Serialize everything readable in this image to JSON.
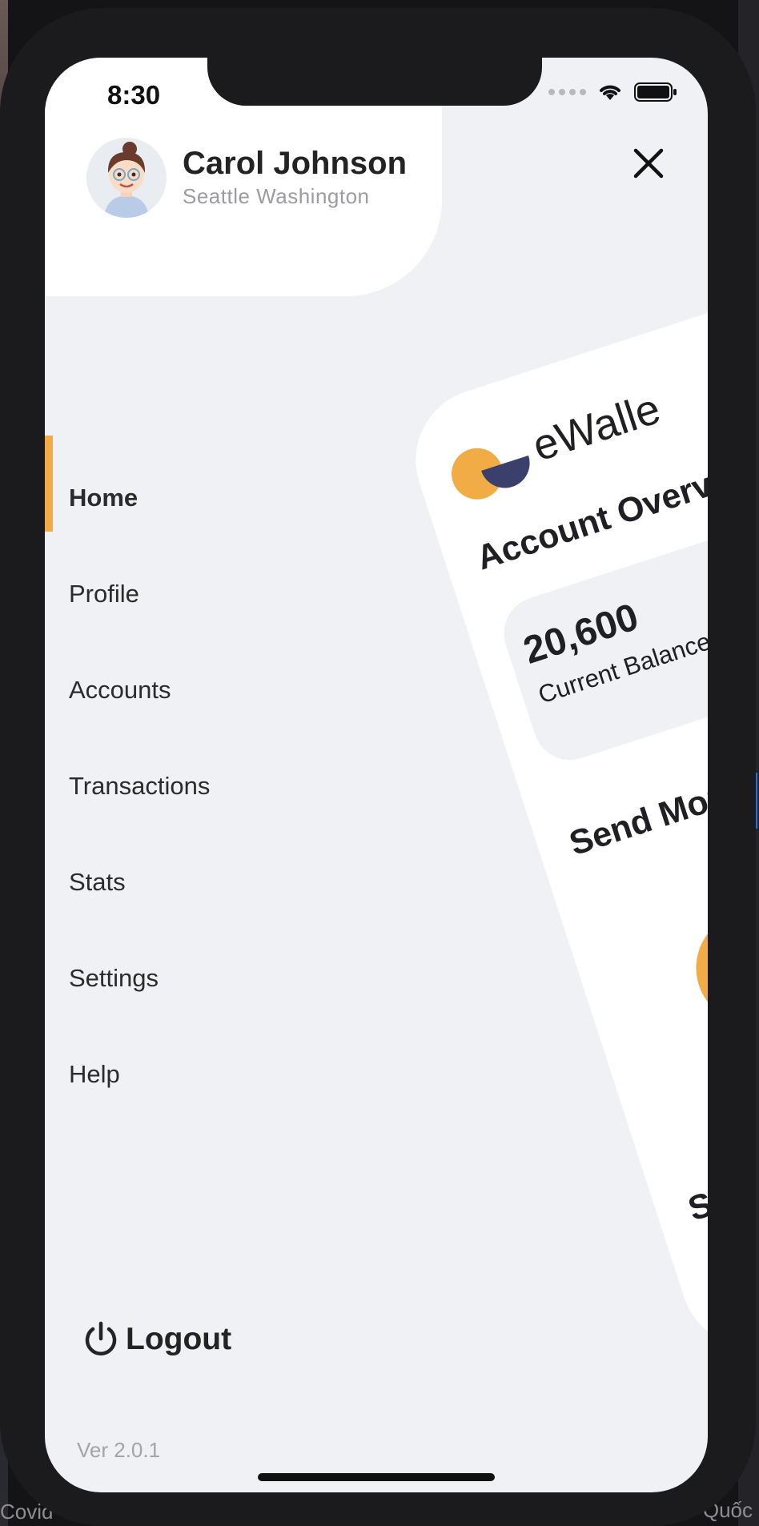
{
  "status_bar": {
    "time": "8:30"
  },
  "user": {
    "name": "Carol Johnson",
    "location": "Seattle Washington"
  },
  "menu": {
    "items": [
      {
        "label": "Home",
        "active": true
      },
      {
        "label": "Profile",
        "active": false
      },
      {
        "label": "Accounts",
        "active": false
      },
      {
        "label": "Transactions",
        "active": false
      },
      {
        "label": "Stats",
        "active": false
      },
      {
        "label": "Settings",
        "active": false
      },
      {
        "label": "Help",
        "active": false
      }
    ]
  },
  "logout_label": "Logout",
  "version": "Ver 2.0.1",
  "preview": {
    "brand": "eWalle",
    "heading": "Account Overview",
    "balance_amount": "20,600",
    "balance_label": "Current Balance",
    "send_money": "Send Money",
    "services": "Service"
  },
  "background": {
    "bottom_left_text": "Covid",
    "bottom_right_text": "Quốc"
  },
  "icons": {
    "close": "close-icon",
    "power": "power-icon",
    "wifi": "wifi-icon",
    "battery": "battery-icon",
    "plus": "plus-icon"
  },
  "colors": {
    "accent": "#f2ac45",
    "brand_dark": "#3b3f6b",
    "screen_bg": "#f0f1f5"
  }
}
